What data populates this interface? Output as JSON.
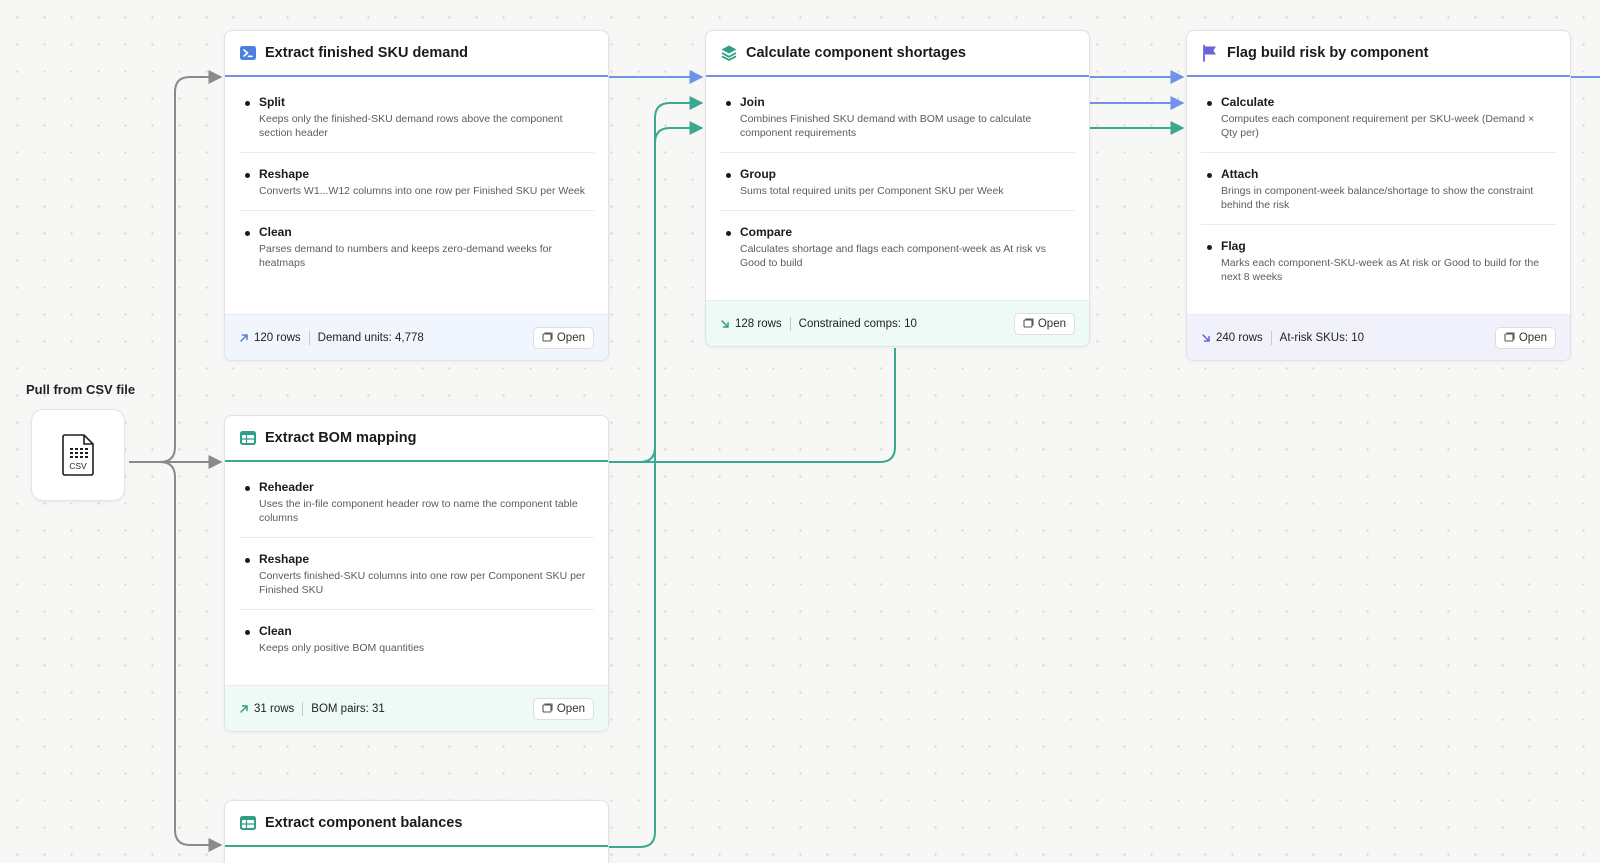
{
  "source": {
    "label": "Pull from CSV file",
    "icon_text": "CSV",
    "icon": "csv-file-icon"
  },
  "colors": {
    "blue_edge": "#6e93e8",
    "teal_edge": "#3aa98f",
    "gray_edge": "#8a8a8a",
    "purple_icon": "#6b63d8"
  },
  "cards": {
    "sku_demand": {
      "title": "Extract finished SKU demand",
      "icon": "terminal-icon",
      "steps": [
        {
          "name": "Split",
          "desc": "Keeps only the finished-SKU demand rows above the component section header"
        },
        {
          "name": "Reshape",
          "desc": "Converts W1...W12 columns into one row per Finished SKU per Week"
        },
        {
          "name": "Clean",
          "desc": "Parses demand to numbers and keeps zero-demand weeks for heatmaps"
        }
      ],
      "footer": {
        "rows": "120 rows",
        "metric": "Demand units: 4,778",
        "open": "Open"
      }
    },
    "bom_mapping": {
      "title": "Extract BOM mapping",
      "icon": "table-icon",
      "steps": [
        {
          "name": "Reheader",
          "desc": "Uses the in-file component header row to name the component table columns"
        },
        {
          "name": "Reshape",
          "desc": "Converts finished-SKU columns into one row per Component SKU per Finished SKU"
        },
        {
          "name": "Clean",
          "desc": "Keeps only positive BOM quantities"
        }
      ],
      "footer": {
        "rows": "31 rows",
        "metric": "BOM pairs: 31",
        "open": "Open"
      }
    },
    "balances": {
      "title": "Extract component balances",
      "icon": "table-icon"
    },
    "shortages": {
      "title": "Calculate component shortages",
      "icon": "layers-icon",
      "steps": [
        {
          "name": "Join",
          "desc": "Combines Finished SKU demand with BOM usage to calculate component requirements"
        },
        {
          "name": "Group",
          "desc": "Sums total required units per Component SKU per Week"
        },
        {
          "name": "Compare",
          "desc": "Calculates shortage and flags each component-week as At risk vs Good to build"
        }
      ],
      "footer": {
        "rows": "128 rows",
        "metric": "Constrained comps: 10",
        "open": "Open"
      }
    },
    "build_risk": {
      "title": "Flag build risk by component",
      "icon": "flag-icon",
      "steps": [
        {
          "name": "Calculate",
          "desc": "Computes each component requirement per SKU-week (Demand × Qty per)"
        },
        {
          "name": "Attach",
          "desc": "Brings in component-week balance/shortage to show the constraint behind the risk"
        },
        {
          "name": "Flag",
          "desc": "Marks each component-SKU-week as At risk or Good to build for the next 8 weeks"
        }
      ],
      "footer": {
        "rows": "240 rows",
        "metric": "At-risk SKUs: 10",
        "open": "Open"
      }
    }
  }
}
